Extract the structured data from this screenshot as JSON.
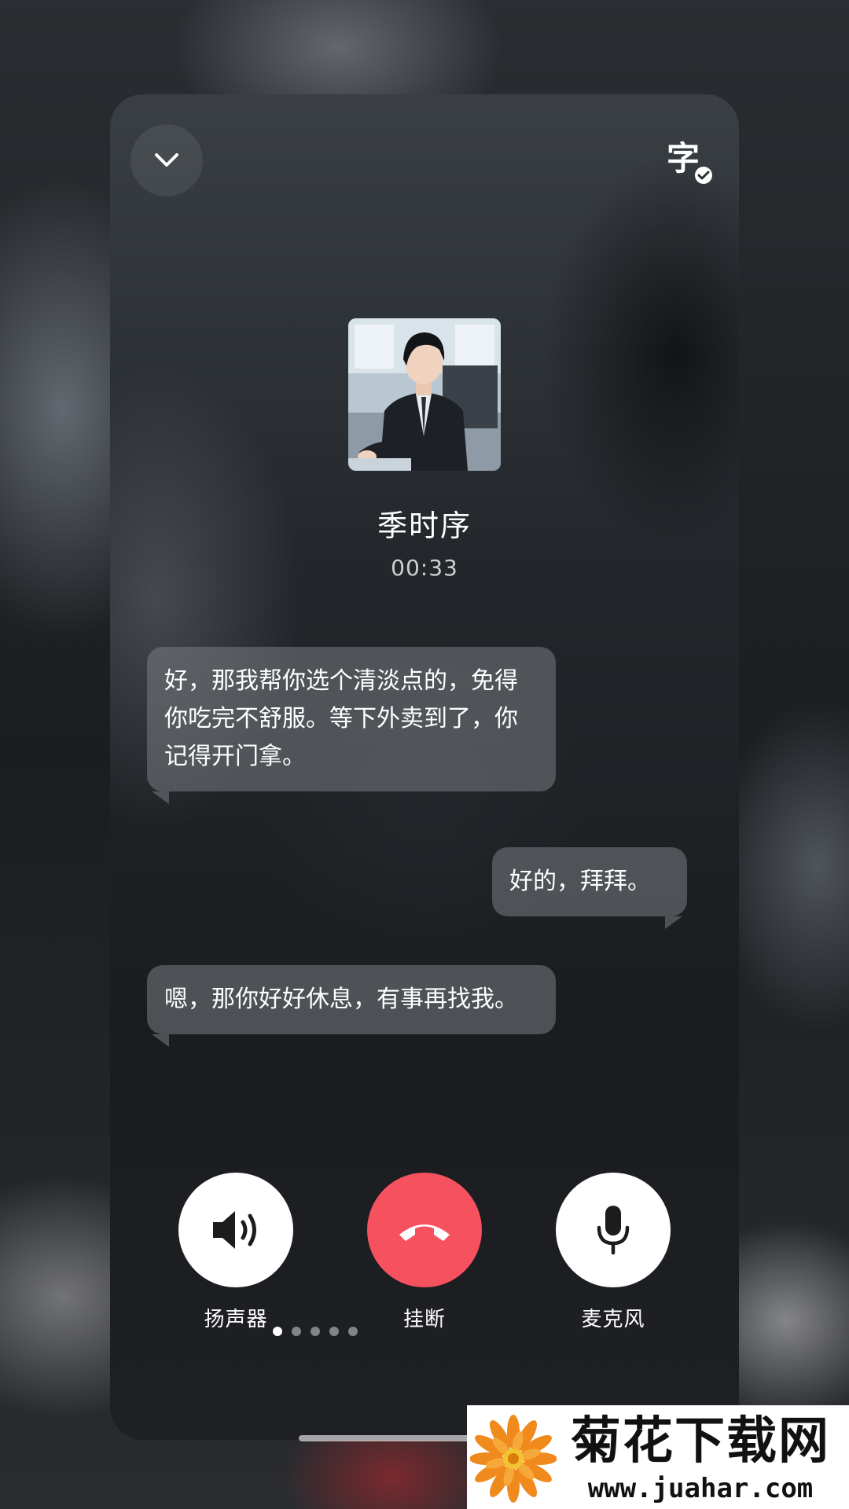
{
  "call": {
    "caller_name": "季时序",
    "timer": "00:33",
    "subtitle_toggle_glyph": "字"
  },
  "messages": [
    {
      "side": "left",
      "text": "好，那我帮你选个清淡点的，免得你吃完不舒服。等下外卖到了，你记得开门拿。"
    },
    {
      "side": "right",
      "text": "好的，拜拜。"
    },
    {
      "side": "left",
      "text": "嗯，那你好好休息，有事再找我。"
    }
  ],
  "controls": {
    "speaker_label": "扬声器",
    "hangup_label": "挂断",
    "mic_label": "麦克风"
  },
  "colors": {
    "hangup": "#f5515f",
    "control_bg": "#ffffff",
    "icon_dark": "#1c1c1e"
  },
  "pager": {
    "count": 5,
    "active": 0
  },
  "watermark": {
    "title": "菊花下载网",
    "url": "www.juahar.com"
  }
}
